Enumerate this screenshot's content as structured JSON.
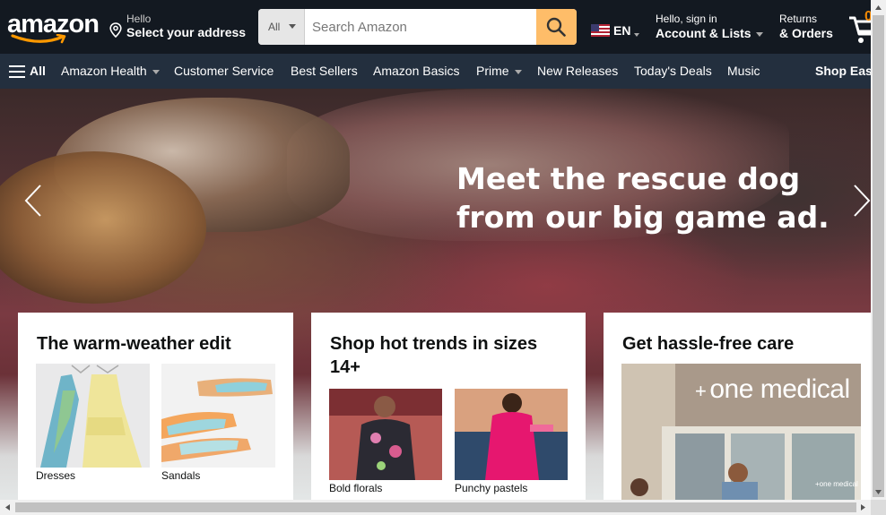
{
  "header": {
    "logo": "amazon",
    "address": {
      "line1": "Hello",
      "line2": "Select your address"
    },
    "search": {
      "category": "All",
      "placeholder": "Search Amazon"
    },
    "language": {
      "code": "EN"
    },
    "account": {
      "line1": "Hello, sign in",
      "line2": "Account & Lists"
    },
    "orders": {
      "line1": "Returns",
      "line2": "& Orders"
    },
    "cart": {
      "count": "0"
    }
  },
  "subnav": {
    "all_label": "All",
    "items": [
      {
        "label": "Amazon Health",
        "dropdown": true
      },
      {
        "label": "Customer Service",
        "dropdown": false
      },
      {
        "label": "Best Sellers",
        "dropdown": false
      },
      {
        "label": "Amazon Basics",
        "dropdown": false
      },
      {
        "label": "Prime",
        "dropdown": true
      },
      {
        "label": "New Releases",
        "dropdown": false
      },
      {
        "label": "Today's Deals",
        "dropdown": false
      },
      {
        "label": "Music",
        "dropdown": false
      }
    ],
    "promo": "Shop Eas"
  },
  "hero": {
    "headline_line1": "Meet the rescue dog",
    "headline_line2": "from our big game ad."
  },
  "cards": [
    {
      "title": "The warm-weather edit",
      "items": [
        {
          "caption": "Dresses"
        },
        {
          "caption": "Sandals"
        }
      ]
    },
    {
      "title": "Shop hot trends in sizes 14+",
      "items": [
        {
          "caption": "Bold florals"
        },
        {
          "caption": "Punchy pastels"
        }
      ]
    },
    {
      "title": "Get hassle-free care",
      "sign_text": "one medical",
      "small_sign": "+one medical"
    }
  ],
  "colors": {
    "nav_bg": "#131921",
    "subnav_bg": "#232f3e",
    "search_button": "#febd69",
    "logo_smile": "#ff9900",
    "cart_count": "#f08804"
  }
}
